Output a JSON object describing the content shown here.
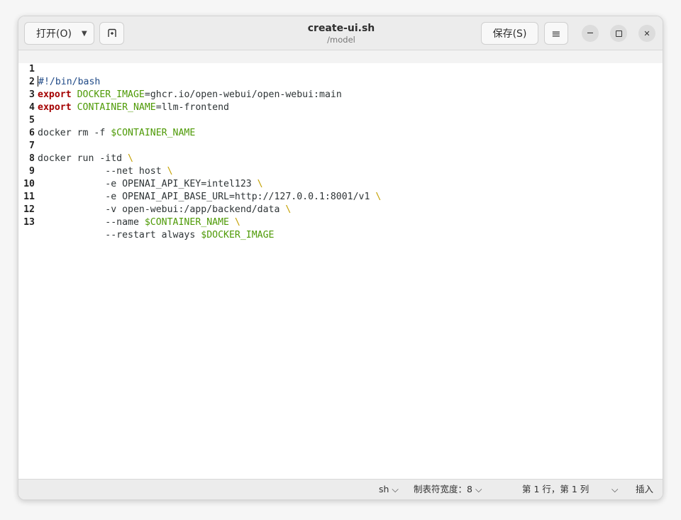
{
  "header": {
    "open_label": "打开(O)",
    "title": "create-ui.sh",
    "subtitle": "/model",
    "save_label": "保存(S)",
    "menu_glyph": "≡",
    "minimize_glyph": "—",
    "close_glyph": "✕"
  },
  "editor": {
    "lines": [
      {
        "n": "1"
      },
      {
        "n": "2"
      },
      {
        "n": "3"
      },
      {
        "n": "4"
      },
      {
        "n": "5"
      },
      {
        "n": "6"
      },
      {
        "n": "7"
      },
      {
        "n": "8"
      },
      {
        "n": "9"
      },
      {
        "n": "10"
      },
      {
        "n": "11"
      },
      {
        "n": "12"
      },
      {
        "n": "13"
      }
    ],
    "tokens": {
      "l1": "#!/bin/bash",
      "l2_kw": "export",
      "l2_var": "DOCKER_IMAGE",
      "l2_rest": "=ghcr.io/open-webui/open-webui:main",
      "l3_kw": "export",
      "l3_var": "CONTAINER_NAME",
      "l3_rest": "=llm-frontend",
      "l5_cmd": "docker rm -f ",
      "l5_var": "$CONTAINER_NAME",
      "l7_cmd": "docker run -itd ",
      "bs": "\\",
      "l8": "            --net host ",
      "l9": "            -e OPENAI_API_KEY=intel123 ",
      "l10": "            -e OPENAI_API_BASE_URL=http://127.0.0.1:8001/v1 ",
      "l11": "            -v open-webui:/app/backend/data ",
      "l12_a": "            --name ",
      "l12_var": "$CONTAINER_NAME",
      "l13_a": "            --restart always ",
      "l13_var": "$DOCKER_IMAGE"
    }
  },
  "status": {
    "language": "sh",
    "tab_width": "制表符宽度：8",
    "position": "第 1 行，第 1 列",
    "insert_mode": "插入",
    "chevron": "⌵"
  }
}
